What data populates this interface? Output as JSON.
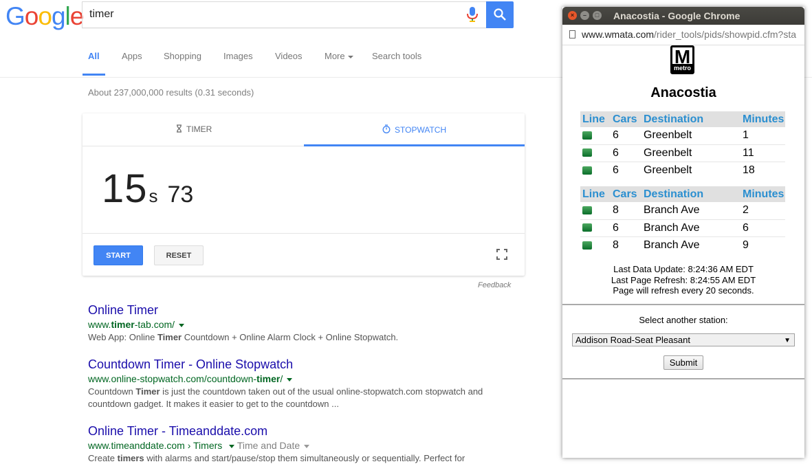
{
  "google": {
    "logo": "Google",
    "search_query": "timer",
    "tabs": [
      {
        "label": "All"
      },
      {
        "label": "Apps"
      },
      {
        "label": "Shopping"
      },
      {
        "label": "Images"
      },
      {
        "label": "Videos"
      },
      {
        "label": "More"
      },
      {
        "label": "Search tools"
      }
    ],
    "stats": "About 237,000,000 results (0.31 seconds)",
    "stopwatch": {
      "tab_timer": "TIMER",
      "tab_stopwatch": "STOPWATCH",
      "seconds": "15",
      "seconds_unit": "s",
      "centiseconds": "73",
      "start_label": "START",
      "reset_label": "RESET"
    },
    "feedback": "Feedback",
    "results": [
      {
        "title": "Online Timer",
        "url_pre": "www.",
        "url_bold": "timer",
        "url_post": "-tab.com/",
        "snippet_pre": "Web App: Online ",
        "snippet_bold": "Timer",
        "snippet_post": " Countdown + Online Alarm Clock + Online Stopwatch."
      },
      {
        "title": "Countdown Timer - Online Stopwatch",
        "url_pre": "www.online-stopwatch.com/countdown-",
        "url_bold": "timer",
        "url_post": "/",
        "snippet_pre": "Countdown ",
        "snippet_bold": "Timer",
        "snippet_post": " is just the countdown taken out of the usual online-stopwatch.com stopwatch and countdown gadget. It makes it easier to get to the countdown ..."
      },
      {
        "title": "Online Timer - Timeanddate.com",
        "url_pre": "www.timeanddate.com › Timers",
        "url_sub": "Time and Date",
        "snippet_pre": "Create ",
        "snippet_bold": "timers",
        "snippet_post": " with alarms and start/pause/stop them simultaneously or sequentially. Perfect for"
      }
    ]
  },
  "chrome": {
    "window_title": "Anacostia - Google Chrome",
    "address_host": "www.wmata.com",
    "address_path": "/rider_tools/pids/showpid.cfm?sta",
    "logo_letter": "M",
    "logo_text": "metro",
    "station": "Anacostia",
    "headers": {
      "line": "Line",
      "cars": "Cars",
      "destination": "Destination",
      "minutes": "Minutes"
    },
    "line_color": "#1a8a3a",
    "group1": [
      {
        "cars": "6",
        "destination": "Greenbelt",
        "minutes": "1"
      },
      {
        "cars": "6",
        "destination": "Greenbelt",
        "minutes": "11"
      },
      {
        "cars": "6",
        "destination": "Greenbelt",
        "minutes": "18"
      }
    ],
    "group2": [
      {
        "cars": "8",
        "destination": "Branch Ave",
        "minutes": "2"
      },
      {
        "cars": "6",
        "destination": "Branch Ave",
        "minutes": "6"
      },
      {
        "cars": "8",
        "destination": "Branch Ave",
        "minutes": "9"
      }
    ],
    "last_data_update": "Last Data Update: 8:24:36 AM EDT",
    "last_page_refresh": "Last Page Refresh: 8:24:55 AM EDT",
    "refresh_note": "Page will refresh every 20 seconds.",
    "select_label": "Select another station:",
    "select_value": "Addison Road-Seat Pleasant",
    "submit_label": "Submit"
  }
}
